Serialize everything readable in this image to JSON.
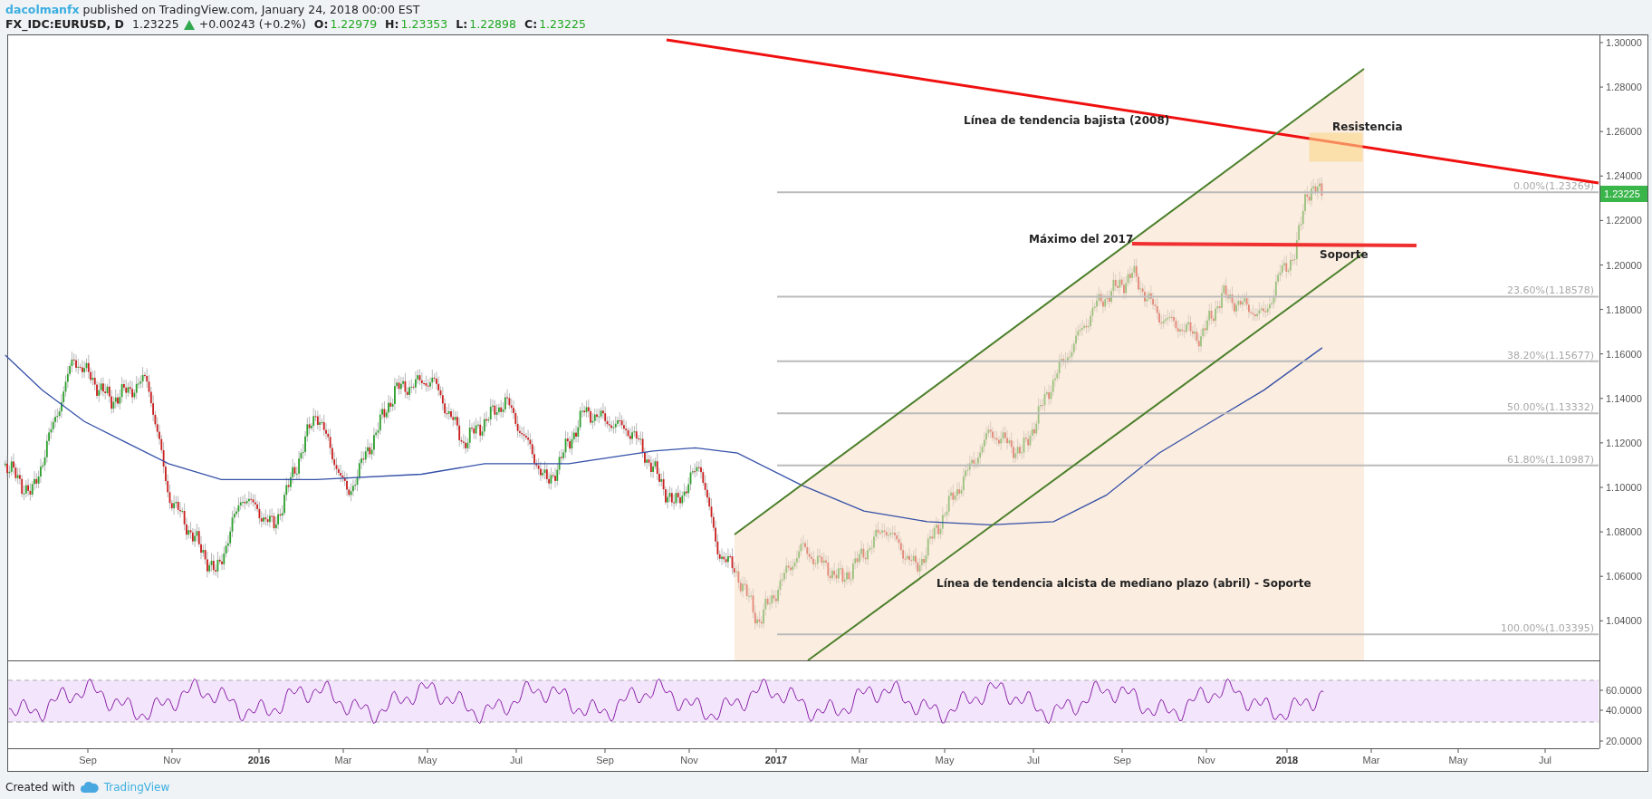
{
  "header": {
    "author": "dacolmanfx",
    "published_text": "published on TradingView.com, January 24, 2018 00:00 EST"
  },
  "symbol_line": {
    "symbol": "FX_IDC:EURUSD, D",
    "price": "1.23225",
    "rising": true,
    "change": "+0.00243 (+0.2%)",
    "ohlc": [
      {
        "label": "O:",
        "value": "1.22979"
      },
      {
        "label": "H:",
        "value": "1.23353"
      },
      {
        "label": "L:",
        "value": "1.22898"
      },
      {
        "label": "C:",
        "value": "1.23225"
      }
    ]
  },
  "chart": {
    "price_axis": [
      "1.30000",
      "1.28000",
      "1.26000",
      "1.24000",
      "1.22000",
      "1.20000",
      "1.18000",
      "1.16000",
      "1.14000",
      "1.12000",
      "1.10000",
      "1.08000",
      "1.06000",
      "1.04000"
    ],
    "last_price": "1.23225",
    "rsi_axis": [
      "60.0000",
      "40.0000",
      "20.0000"
    ],
    "time_axis": [
      {
        "label": "Sep",
        "kind": "month"
      },
      {
        "label": "Nov",
        "kind": "month"
      },
      {
        "label": "2016",
        "kind": "year"
      },
      {
        "label": "Mar",
        "kind": "month"
      },
      {
        "label": "May",
        "kind": "month"
      },
      {
        "label": "Jul",
        "kind": "month"
      },
      {
        "label": "Sep",
        "kind": "month"
      },
      {
        "label": "Nov",
        "kind": "month"
      },
      {
        "label": "2017",
        "kind": "year"
      },
      {
        "label": "Mar",
        "kind": "month"
      },
      {
        "label": "May",
        "kind": "month"
      },
      {
        "label": "Jul",
        "kind": "month"
      },
      {
        "label": "Sep",
        "kind": "month"
      },
      {
        "label": "Nov",
        "kind": "month"
      },
      {
        "label": "2018",
        "kind": "year"
      },
      {
        "label": "Mar",
        "kind": "month"
      },
      {
        "label": "May",
        "kind": "month"
      },
      {
        "label": "Jul",
        "kind": "month"
      }
    ],
    "fib_levels": [
      "0.00%(1.23269)",
      "23.60%(1.18578)",
      "38.20%(1.15677)",
      "50.00%(1.13332)",
      "61.80%(1.10987)",
      "100.00%(1.03395)"
    ],
    "annotations": [
      "Línea de tendencia bajista (2008)",
      "Resistencia",
      "Máximo del 2017",
      "Soporte",
      "Línea de tendencia alcista de mediano plazo (abril) - Soporte"
    ]
  },
  "footer": {
    "created_text": "Created with",
    "brand": "TradingView"
  }
}
